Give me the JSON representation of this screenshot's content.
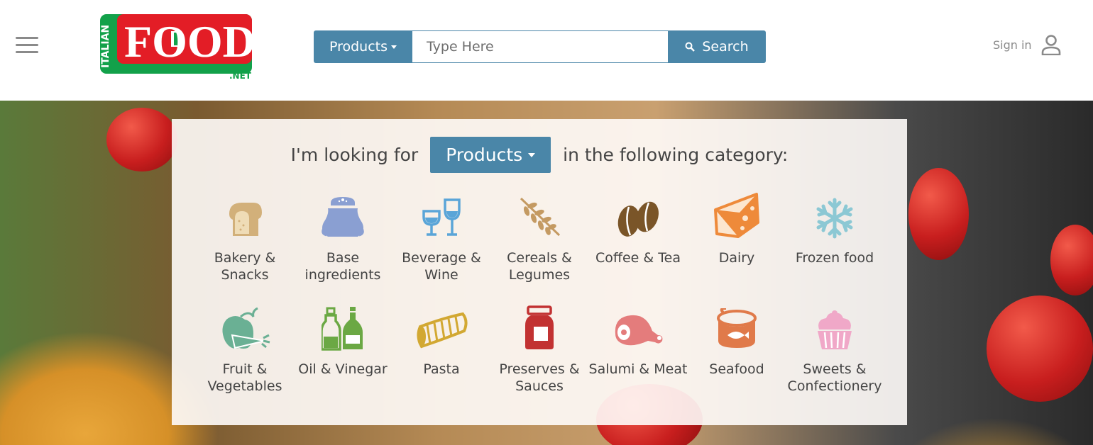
{
  "header": {
    "logo": {
      "top_word": "ITALIAN",
      "word": "FOOD",
      "suffix": ".NET"
    },
    "search": {
      "dropdown_label": "Products",
      "placeholder": "Type Here",
      "button_label": "Search"
    },
    "signin_label": "Sign in"
  },
  "hero": {
    "prefix": "I'm looking for",
    "dropdown_label": "Products",
    "suffix": "in the following category:",
    "categories": [
      {
        "label": "Bakery & Snacks",
        "icon": "bread-icon",
        "color": "#d2b07a"
      },
      {
        "label": "Base ingredients",
        "icon": "flour-sack-icon",
        "color": "#8a9fd2"
      },
      {
        "label": "Beverage & Wine",
        "icon": "wine-glasses-icon",
        "color": "#5aa5d8"
      },
      {
        "label": "Cereals & Legumes",
        "icon": "wheat-icon",
        "color": "#c49a62"
      },
      {
        "label": "Coffee & Tea",
        "icon": "coffee-beans-icon",
        "color": "#7a5528"
      },
      {
        "label": "Dairy",
        "icon": "cheese-icon",
        "color": "#ee8a3a"
      },
      {
        "label": "Frozen food",
        "icon": "snowflake-icon",
        "color": "#8cc8d4"
      },
      {
        "label": "Fruit & Vegetables",
        "icon": "apple-carrot-icon",
        "color": "#6ab094"
      },
      {
        "label": "Oil & Vinegar",
        "icon": "bottles-icon",
        "color": "#6ba844"
      },
      {
        "label": "Pasta",
        "icon": "pasta-icon",
        "color": "#d2a832"
      },
      {
        "label": "Preserves & Sauces",
        "icon": "jar-icon",
        "color": "#c23232"
      },
      {
        "label": "Salumi & Meat",
        "icon": "ham-icon",
        "color": "#e47c7c"
      },
      {
        "label": "Seafood",
        "icon": "tuna-can-icon",
        "color": "#e07a4a"
      },
      {
        "label": "Sweets & Confectionery",
        "icon": "cupcake-icon",
        "color": "#f0a8c8"
      }
    ]
  },
  "colors": {
    "accent": "#4a86a8",
    "logo_red": "#e31d26",
    "logo_green": "#12a14a"
  }
}
